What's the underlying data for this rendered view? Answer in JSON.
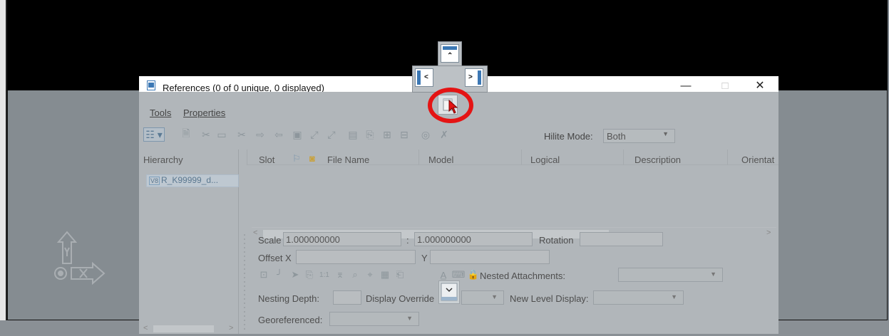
{
  "dialog": {
    "title": "References (0 of 0 unique, 0 displayed)",
    "window_controls": {
      "minimize": "—",
      "maximize": "□",
      "close": "✕"
    },
    "menu": {
      "tools": "Tools",
      "properties": "Properties"
    },
    "toolbar": {
      "hilite_label": "Hilite Mode:",
      "hilite_value": "Both",
      "icons": [
        "hierarchy-view-icon",
        "attach-reference-icon",
        "detach-icon",
        "reload-icon",
        "clip-boundary-icon",
        "move-icon",
        "copy-icon",
        "scale-icon",
        "rotate-icon",
        "mirror-icon",
        "clip-mask-icon",
        "clip-delete-icon",
        "reload-all-icon",
        "exchange-icon",
        "merge-icon",
        "delete-icon"
      ]
    },
    "hierarchy": {
      "header": "Hierarchy",
      "item_badge": "V8",
      "item_label": "R_K99999_d..."
    },
    "table": {
      "columns": [
        "Slot",
        "",
        "",
        "File Name",
        "Model",
        "Logical",
        "Description",
        "Orientat"
      ]
    },
    "properties": {
      "scale_label": "Scale",
      "scale_value_1": "1.000000000",
      "scale_separator": ":",
      "scale_value_2": "1.000000000",
      "rotation_label": "Rotation",
      "offset_x_label": "Offset X",
      "offset_y_label": "Y",
      "nested_attachments_label": "Nested Attachments:",
      "nesting_depth_label": "Nesting Depth:",
      "display_overrides_label": "Display Overrides:",
      "display_overrides_visible": "Display Override",
      "new_level_display_label": "New Level Display:",
      "georeferenced_label": "Georeferenced:"
    }
  },
  "annotation": {
    "highlight_color": "#e41414"
  },
  "colors": {
    "dock_accent": "#3c78b5",
    "view_top": "#000000",
    "view_bottom": "#858c91"
  }
}
